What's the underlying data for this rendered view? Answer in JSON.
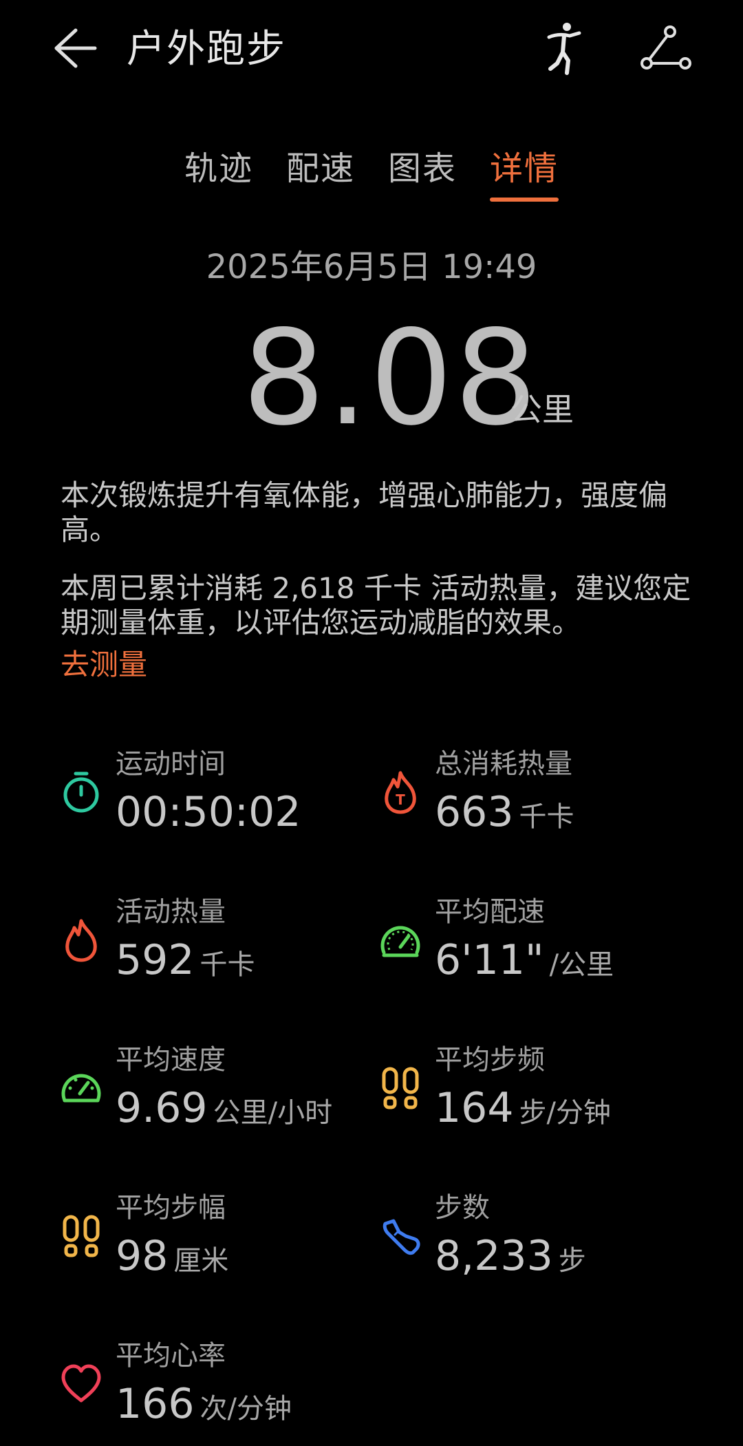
{
  "header": {
    "title": "户外跑步",
    "icons": [
      "back-icon",
      "runner-icon",
      "route-icon"
    ]
  },
  "tabs": [
    {
      "label": "轨迹",
      "active": false
    },
    {
      "label": "配速",
      "active": false
    },
    {
      "label": "图表",
      "active": false
    },
    {
      "label": "详情",
      "active": true
    }
  ],
  "summary": {
    "datetime": "2025年6月5日 19:49",
    "distance": "8.08",
    "distance_unit": "公里"
  },
  "description": {
    "line1": "本次锻炼提升有氧体能，增强心肺能力，强度偏高。",
    "line2": "本周已累计消耗 2,618 千卡 活动热量，建议您定期测量体重，以评估您运动减脂的效果。",
    "link": "去测量"
  },
  "colors": {
    "accent": "#f0703d",
    "background": "#000000",
    "stopwatch": "#2ec9a0",
    "flame": "#f0553a",
    "gauge": "#5bd65a",
    "footprint": "#f2b64a",
    "shoe": "#3f7cf0",
    "heart": "#f04058"
  },
  "stats": {
    "time": {
      "label": "运动时间",
      "value": "00:50:02",
      "unit": "",
      "icon": "stopwatch-icon"
    },
    "total_calories": {
      "label": "总消耗热量",
      "value": "663",
      "unit": "千卡",
      "icon": "total-flame-icon"
    },
    "active_calories": {
      "label": "活动热量",
      "value": "592",
      "unit": "千卡",
      "icon": "flame-icon"
    },
    "avg_pace": {
      "label": "平均配速",
      "value": "6'11\"",
      "unit": "/公里",
      "icon": "speedometer-icon"
    },
    "avg_speed": {
      "label": "平均速度",
      "value": "9.69",
      "unit": "公里/小时",
      "icon": "gauge-icon"
    },
    "avg_cadence": {
      "label": "平均步频",
      "value": "164",
      "unit": "步/分钟",
      "icon": "footprints-icon"
    },
    "avg_stride": {
      "label": "平均步幅",
      "value": "98",
      "unit": "厘米",
      "icon": "footprints-icon"
    },
    "steps": {
      "label": "步数",
      "value": "8,233",
      "unit": "步",
      "icon": "shoe-icon"
    },
    "avg_heart_rate": {
      "label": "平均心率",
      "value": "166",
      "unit": "次/分钟",
      "icon": "heart-icon"
    }
  }
}
